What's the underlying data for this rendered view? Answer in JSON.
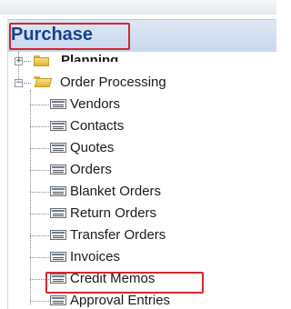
{
  "header": {
    "title": "Purchase"
  },
  "tree": {
    "planning": {
      "label": "Planning",
      "expander": "+"
    },
    "order_processing": {
      "label": "Order Processing",
      "expander": "−"
    },
    "items": [
      {
        "label": "Vendors"
      },
      {
        "label": "Contacts"
      },
      {
        "label": "Quotes"
      },
      {
        "label": "Orders"
      },
      {
        "label": "Blanket Orders"
      },
      {
        "label": "Return Orders"
      },
      {
        "label": "Transfer Orders"
      },
      {
        "label": "Invoices"
      },
      {
        "label": "Credit Memos"
      },
      {
        "label": "Approval Entries"
      }
    ]
  },
  "highlight_color": "#d22630",
  "header_text_color": "#15428b"
}
